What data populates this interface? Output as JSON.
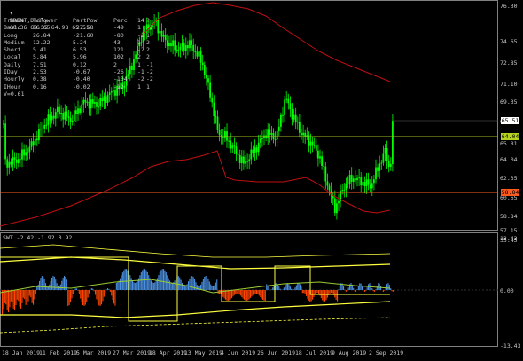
{
  "header": {
    "title": "BRENT,Daily",
    "ohlc": "68.36 68.55 64.98 65.51"
  },
  "colors": {
    "background": "#000000",
    "bull": "#00ff00",
    "bear": "#00ff00",
    "ma": "#c01010",
    "level_green": "#a0c020",
    "level_red": "#ff6020",
    "osc_red": "#ff4500",
    "osc_blue": "#4a90e2",
    "osc_band": "#ffff40"
  },
  "stats_table": {
    "headers": [
      "TrName",
      "TrPower",
      "PartPow",
      "Perc",
      "14",
      "?"
    ],
    "rows": [
      [
        "Basic",
        "56.65",
        "-27.58",
        "-49",
        "1",
        "-1"
      ],
      [
        "Long",
        "26.84",
        "-21.60",
        "-80",
        "-2",
        "1"
      ],
      [
        "Medium",
        "12.22",
        "5.24",
        "43",
        "1",
        "2"
      ],
      [
        "Short",
        "5.41",
        "6.53",
        "121",
        "-2",
        "2"
      ],
      [
        "Local",
        "5.84",
        "5.96",
        "102",
        "2",
        "2"
      ],
      [
        "Daily",
        "7.51",
        "0.12",
        "2",
        "1",
        "-1"
      ],
      [
        "IDay",
        "2.53",
        "-0.67",
        "-26",
        "-1",
        "-2"
      ],
      [
        "Hourly",
        "0.38",
        "-0.40",
        "-104",
        "-2",
        "-2"
      ],
      [
        "IHour",
        "0.16",
        "-0.02",
        "-12",
        "1",
        "1"
      ]
    ],
    "footer": "V=0.61"
  },
  "price_axis": {
    "labels": [
      "76.30",
      "74.65",
      "72.85",
      "71.10",
      "69.35",
      "67.60",
      "65.81",
      "64.04",
      "62.35",
      "60.65",
      "58.84",
      "57.15",
      "55.45"
    ],
    "current_tag": "65.51",
    "green_level_tag": "64.04",
    "red_level_tag": "58.84"
  },
  "oscillator": {
    "title": "SWT -2.42 -1.92 0.92",
    "axis_labels": [
      "13.43",
      "0.00",
      "-13.43"
    ]
  },
  "date_axis": [
    "18 Jan 2019",
    "11 Feb 2019",
    "5 Mar 2019",
    "27 Mar 2019",
    "18 Apr 2019",
    "13 May 2019",
    "4 Jun 2019",
    "26 Jun 2019",
    "18 Jul 2019",
    "9 Aug 2019",
    "2 Sep 2019"
  ]
}
